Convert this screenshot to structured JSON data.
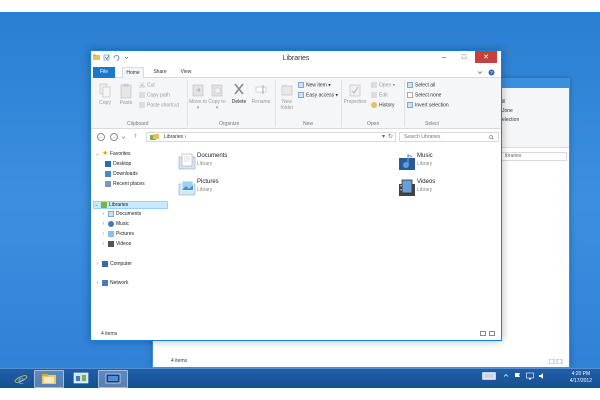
{
  "colors": {
    "desktop": "#2a7fd3",
    "accent": "#1979ca",
    "close": "#c7403a",
    "taskbar": "#1f5fa8"
  },
  "window": {
    "title": "Libraries",
    "controls": {
      "minimize": "–",
      "maximize": "□",
      "close": "✕"
    },
    "tabs": [
      "File",
      "Home",
      "Share",
      "View"
    ],
    "ribbon": {
      "clipboard": {
        "copy": "Copy",
        "paste": "Paste",
        "cut": "Cut",
        "copy_path": "Copy path",
        "paste_shortcut": "Paste shortcut",
        "label": "Clipboard"
      },
      "organize": {
        "move_to": "Move to ▾",
        "copy_to": "Copy to ▾",
        "delete": "Delete",
        "rename": "Rename",
        "label": "Organize"
      },
      "new": {
        "new_folder": "New folder",
        "new_item": "New item ▾",
        "easy_access": "Easy access ▾",
        "label": "New"
      },
      "open": {
        "properties": "Properties",
        "open": "Open ▾",
        "edit": "Edit",
        "history": "History",
        "label": "Open"
      },
      "select": {
        "select_all": "Select all",
        "select_none": "Select none",
        "invert": "Invert selection",
        "label": "Select"
      }
    },
    "address": {
      "path": "Libraries ›",
      "search_placeholder": "Search Libraries"
    },
    "nav": {
      "favorites": "Favorites",
      "desktop": "Desktop",
      "downloads": "Downloads",
      "recent": "Recent places",
      "libraries": "Libraries",
      "documents": "Documents",
      "music": "Music",
      "pictures": "Pictures",
      "videos": "Videos",
      "computer": "Computer",
      "network": "Network"
    },
    "libraries": [
      {
        "name": "Documents",
        "type": "Library",
        "icon": "documents-library-icon"
      },
      {
        "name": "Music",
        "type": "Library",
        "icon": "music-library-icon"
      },
      {
        "name": "Pictures",
        "type": "Library",
        "icon": "pictures-library-icon"
      },
      {
        "name": "Videos",
        "type": "Library",
        "icon": "videos-library-icon"
      }
    ],
    "status": "4 items"
  },
  "back_window": {
    "ribbon_items": [
      "ill",
      "Jone",
      "election"
    ],
    "address": "ibraries",
    "status": "4 items"
  },
  "taskbar": {
    "items": [
      "internet-explorer-icon",
      "file-explorer-icon",
      "control-panel-icon",
      "remote-desktop-icon"
    ],
    "clock": {
      "time": "4:20 PM",
      "date": "4/17/2012"
    }
  }
}
